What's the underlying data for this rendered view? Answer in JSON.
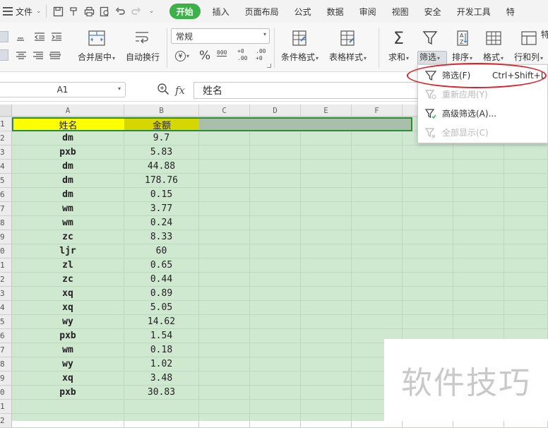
{
  "menubar": {
    "file_label": "文件",
    "tabs": [
      {
        "label": "开始",
        "active": true
      },
      {
        "label": "插入"
      },
      {
        "label": "页面布局"
      },
      {
        "label": "公式"
      },
      {
        "label": "数据"
      },
      {
        "label": "审阅"
      },
      {
        "label": "视图"
      },
      {
        "label": "安全"
      },
      {
        "label": "开发工具"
      },
      {
        "label": "特"
      }
    ],
    "active_color": "#3db149"
  },
  "ribbon": {
    "merge_label": "合并居中",
    "wrap_label": "自动换行",
    "number_format": "常规",
    "currency_symbol": "¥",
    "percent_symbol": "%",
    "thousands_symbol": "000",
    "increase_decimal": "+0 .00",
    "decrease_decimal": ".00 +0",
    "cond_format_label": "条件格式",
    "table_style_label": "表格样式",
    "sum_label": "求和",
    "filter_label": "筛选",
    "sort_label": "排序",
    "format_label": "格式",
    "rowcol_label": "行和列",
    "special_label": "特"
  },
  "formula_bar": {
    "cell_ref": "A1",
    "fx_label": "fx",
    "value": "姓名"
  },
  "sheet": {
    "columns": [
      "A",
      "B",
      "C",
      "D",
      "E",
      "F"
    ],
    "header_row": {
      "name": "姓名",
      "amount": "金额"
    },
    "rows": [
      {
        "name": "dm",
        "amount": "9.7"
      },
      {
        "name": "pxb",
        "amount": "5.83"
      },
      {
        "name": "dm",
        "amount": "44.88"
      },
      {
        "name": "dm",
        "amount": "178.76"
      },
      {
        "name": "dm",
        "amount": "0.15"
      },
      {
        "name": "wm",
        "amount": "3.77"
      },
      {
        "name": "wm",
        "amount": "0.24"
      },
      {
        "name": "zc",
        "amount": "8.33"
      },
      {
        "name": "ljr",
        "amount": "60"
      },
      {
        "name": "zl",
        "amount": "0.65"
      },
      {
        "name": "zc",
        "amount": "0.44"
      },
      {
        "name": "xq",
        "amount": "0.89"
      },
      {
        "name": "xq",
        "amount": "5.05"
      },
      {
        "name": "wy",
        "amount": "14.62"
      },
      {
        "name": "pxb",
        "amount": "1.54"
      },
      {
        "name": "wm",
        "amount": "0.18"
      },
      {
        "name": "wy",
        "amount": "1.02"
      },
      {
        "name": "xq",
        "amount": "3.48"
      },
      {
        "name": "pxb",
        "amount": "30.83"
      }
    ],
    "row_numbers": [
      "1",
      "2",
      "3",
      "4",
      "5",
      "6",
      "7",
      "8",
      "9",
      "0",
      "1",
      "2",
      "3",
      "4",
      "5",
      "6",
      "7",
      "8",
      "9",
      "0",
      "1",
      "2"
    ],
    "header_colors": {
      "name_bg": "#ffff00",
      "amount_bg": "#d7d700",
      "row_bg": "#a9bfa9"
    }
  },
  "filter_menu": {
    "items": [
      {
        "label": "筛选(F)",
        "shortcut": "Ctrl+Shift+L",
        "enabled": true
      },
      {
        "label": "重新应用(Y)",
        "enabled": false
      },
      {
        "label": "高级筛选(A)...",
        "enabled": true
      },
      {
        "label": "全部显示(C)",
        "enabled": false
      }
    ],
    "highlight_color": "#d9232a"
  },
  "watermark": {
    "text": "软件技巧"
  }
}
